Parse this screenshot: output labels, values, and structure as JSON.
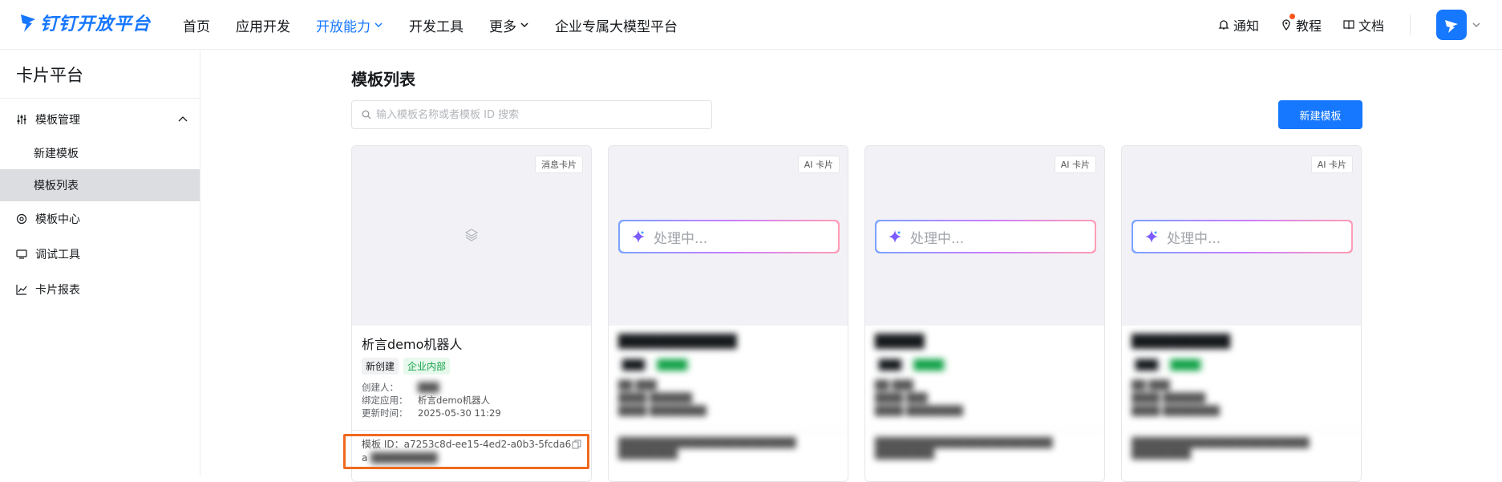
{
  "logo": {
    "text": "钉钉开放平台"
  },
  "nav": {
    "items": [
      "首页",
      "应用开发",
      "开放能力",
      "开发工具",
      "更多",
      "企业专属大模型平台"
    ],
    "right": {
      "notify": "通知",
      "tutorial": "教程",
      "docs": "文档"
    }
  },
  "sidebar": {
    "title": "卡片平台",
    "groups": [
      {
        "label": "模板管理"
      },
      {
        "label": "模板中心"
      },
      {
        "label": "调试工具"
      },
      {
        "label": "卡片报表"
      }
    ],
    "subitems": [
      "新建模板",
      "模板列表"
    ]
  },
  "main": {
    "title": "模板列表",
    "search_placeholder": "输入模板名称或者模板 ID 搜索",
    "new_button": "新建模板"
  },
  "cards": [
    {
      "tag": "消息卡片",
      "name": "析言demo机器人",
      "badge1": "新创建",
      "badge2": "企业内部",
      "creator_key": "创建人：",
      "creator_val": "",
      "app_key": "绑定应用：",
      "app_val": "析言demo机器人",
      "time_key": "更新时间：",
      "time_val": "2025-05-30 11:29",
      "id_label": "模板 ID：a7253c8d-ee15-4ed2-a0b3-5fcda6",
      "id_cont": "a"
    },
    {
      "tag": "AI 卡片",
      "processing": "处理中...",
      "name": "",
      "badge1": "",
      "badge2": "",
      "id_label": ""
    },
    {
      "tag": "AI 卡片",
      "processing": "处理中...",
      "name": "",
      "badge1": "",
      "badge2": "",
      "id_label": ""
    },
    {
      "tag": "AI 卡片",
      "processing": "处理中...",
      "name": "",
      "badge1": "",
      "badge2": "",
      "id_label": ""
    }
  ],
  "colors": {
    "accent": "#1677ff",
    "highlight": "#f06a1e",
    "badge_green": "#15a34a"
  }
}
